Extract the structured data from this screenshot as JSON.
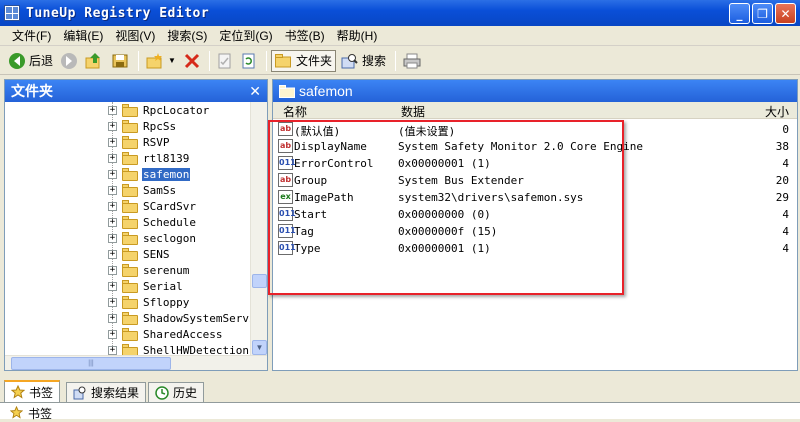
{
  "window": {
    "title": "TuneUp Registry Editor"
  },
  "menu": [
    "文件(F)",
    "编辑(E)",
    "视图(V)",
    "搜索(S)",
    "定位到(G)",
    "书签(B)",
    "帮助(H)"
  ],
  "toolbar": {
    "back_label": "后退",
    "folders_label": "文件夹",
    "search_label": "搜索"
  },
  "left_panel": {
    "title": "文件夹",
    "close_glyph": "✕",
    "tree_items": [
      {
        "label": "RpcLocator",
        "expander": "+"
      },
      {
        "label": "RpcSs",
        "expander": "+"
      },
      {
        "label": "RSVP",
        "expander": "+"
      },
      {
        "label": "rtl8139",
        "expander": "+"
      },
      {
        "label": "safemon",
        "expander": "+",
        "selected": true
      },
      {
        "label": "SamSs",
        "expander": "+"
      },
      {
        "label": "SCardSvr",
        "expander": "+"
      },
      {
        "label": "Schedule",
        "expander": "+"
      },
      {
        "label": "seclogon",
        "expander": "+"
      },
      {
        "label": "SENS",
        "expander": "+"
      },
      {
        "label": "serenum",
        "expander": "+"
      },
      {
        "label": "Serial",
        "expander": "+"
      },
      {
        "label": "Sfloppy",
        "expander": "+"
      },
      {
        "label": "ShadowSystemServic",
        "expander": "+"
      },
      {
        "label": "SharedAccess",
        "expander": "+"
      },
      {
        "label": "ShellHWDetection",
        "expander": "+"
      }
    ]
  },
  "right_panel": {
    "title": "safemon",
    "columns": {
      "name": "名称",
      "data": "数据",
      "size": "大小"
    },
    "values": [
      {
        "type": "ab",
        "kind": "str",
        "name": "(默认值)",
        "data": "(值未设置)",
        "size": "0"
      },
      {
        "type": "ab",
        "kind": "str",
        "name": "DisplayName",
        "data": "System Safety Monitor 2.0 Core Engine",
        "size": "38"
      },
      {
        "type": "011",
        "kind": "num",
        "name": "ErrorControl",
        "data": "0x00000001 (1)",
        "size": "4"
      },
      {
        "type": "ab",
        "kind": "str",
        "name": "Group",
        "data": "System Bus Extender",
        "size": "20"
      },
      {
        "type": "ex",
        "kind": "exp",
        "name": "ImagePath",
        "data": "system32\\drivers\\safemon.sys",
        "size": "29"
      },
      {
        "type": "011",
        "kind": "num",
        "name": "Start",
        "data": "0x00000000 (0)",
        "size": "4"
      },
      {
        "type": "011",
        "kind": "num",
        "name": "Tag",
        "data": "0x0000000f (15)",
        "size": "4"
      },
      {
        "type": "011",
        "kind": "num",
        "name": "Type",
        "data": "0x00000001 (1)",
        "size": "4"
      }
    ]
  },
  "bottom_tabs": [
    {
      "label": "书签",
      "icon": "star-icon",
      "active": true
    },
    {
      "label": "搜索结果",
      "icon": "search-results-icon"
    },
    {
      "label": "历史",
      "icon": "history-icon"
    }
  ],
  "bottom_panel": {
    "title": "书签"
  }
}
